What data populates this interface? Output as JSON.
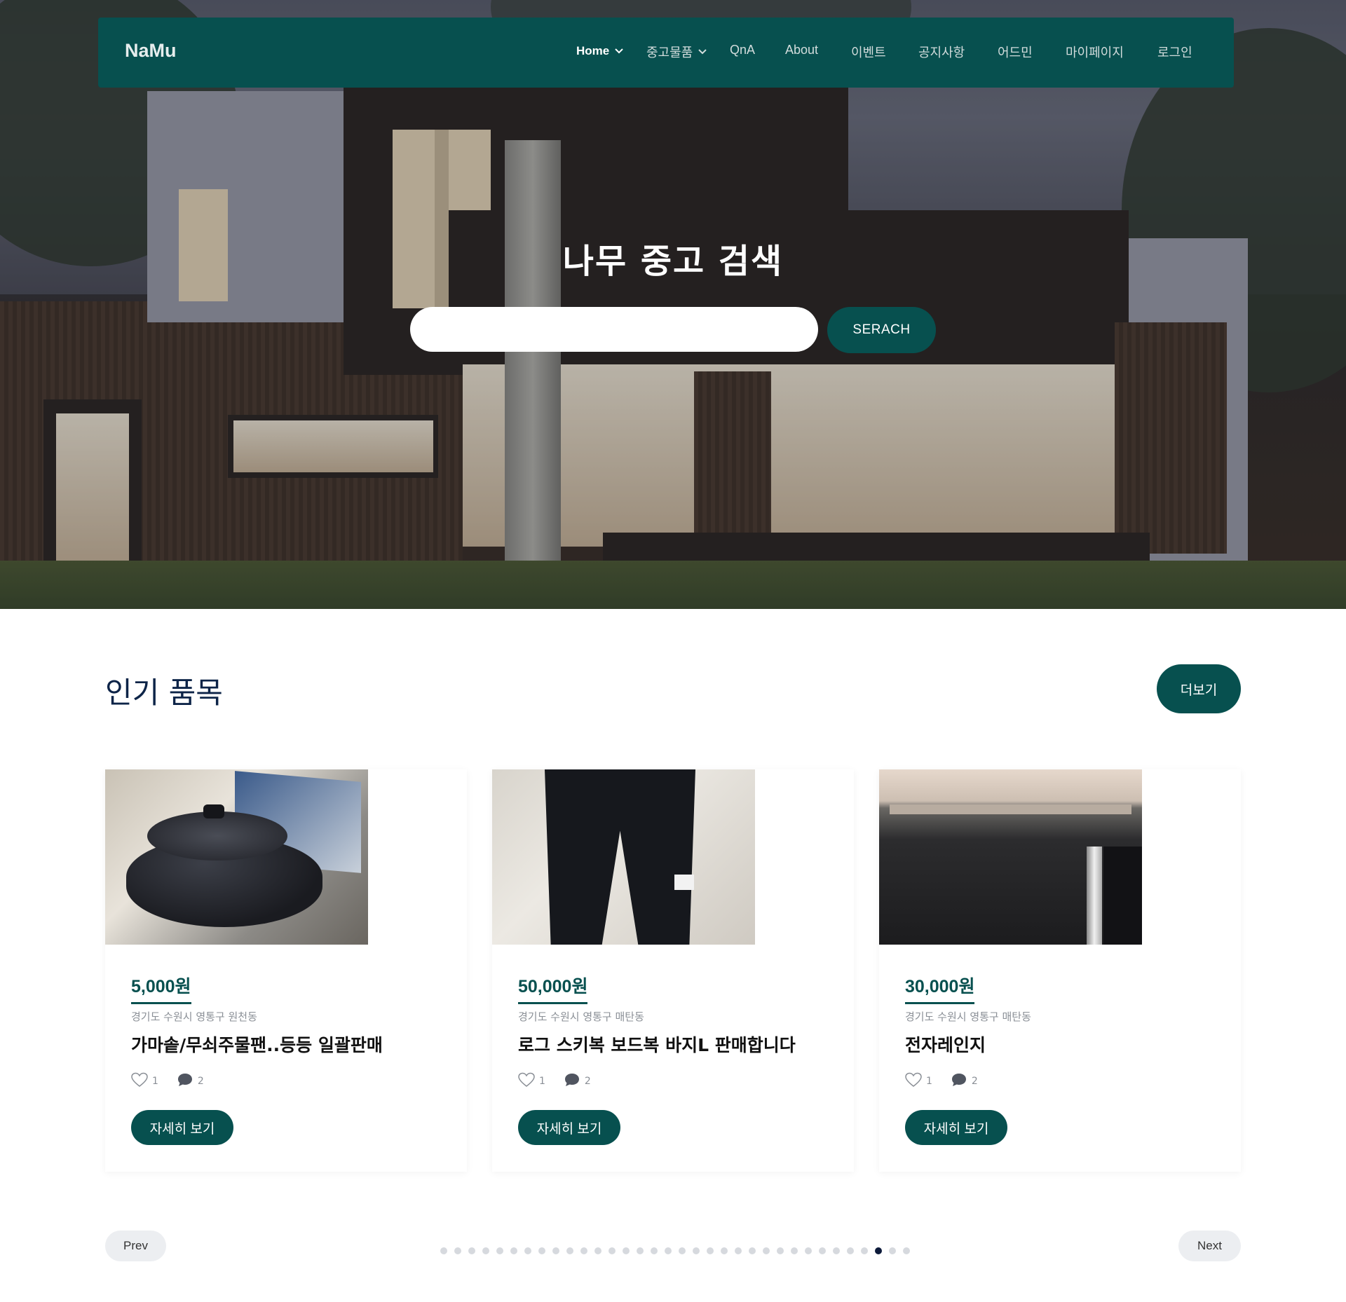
{
  "navbar": {
    "brand": "NaMu",
    "items": [
      {
        "label": "Home",
        "has_dropdown": true,
        "active": true
      },
      {
        "label": "중고물품",
        "has_dropdown": true,
        "active": false
      },
      {
        "label": "QnA",
        "has_dropdown": false,
        "active": false
      },
      {
        "label": "About",
        "has_dropdown": false,
        "active": false
      },
      {
        "label": "이벤트",
        "has_dropdown": false,
        "active": false
      },
      {
        "label": "공지사항",
        "has_dropdown": false,
        "active": false
      },
      {
        "label": "어드민",
        "has_dropdown": false,
        "active": false
      },
      {
        "label": "마이페이지",
        "has_dropdown": false,
        "active": false
      },
      {
        "label": "로그인",
        "has_dropdown": false,
        "active": false
      }
    ]
  },
  "hero": {
    "title": "나무 중고 검색",
    "search_value": "",
    "search_button": "SERACH"
  },
  "popular": {
    "title": "인기 품목",
    "more_button": "더보기",
    "products": [
      {
        "price": "5,000원",
        "location": "경기도 수원시 영통구 원천동",
        "title": "가마솥/무쇠주물팬..등등 일괄판매",
        "likes": "1",
        "comments": "2",
        "button": "자세히 보기"
      },
      {
        "price": "50,000원",
        "location": "경기도 수원시 영통구 매탄동",
        "title": "로그 스키복 보드복 바지L 판매합니다",
        "likes": "1",
        "comments": "2",
        "button": "자세히 보기"
      },
      {
        "price": "30,000원",
        "location": "경기도 수원시 영통구 매탄동",
        "title": "전자레인지",
        "likes": "1",
        "comments": "2",
        "button": "자세히 보기"
      }
    ]
  },
  "pager": {
    "prev": "Prev",
    "next": "Next",
    "total_dots": 34,
    "active_dot": 31
  },
  "colors": {
    "brand": "#07504f",
    "heading": "#0d2448"
  }
}
